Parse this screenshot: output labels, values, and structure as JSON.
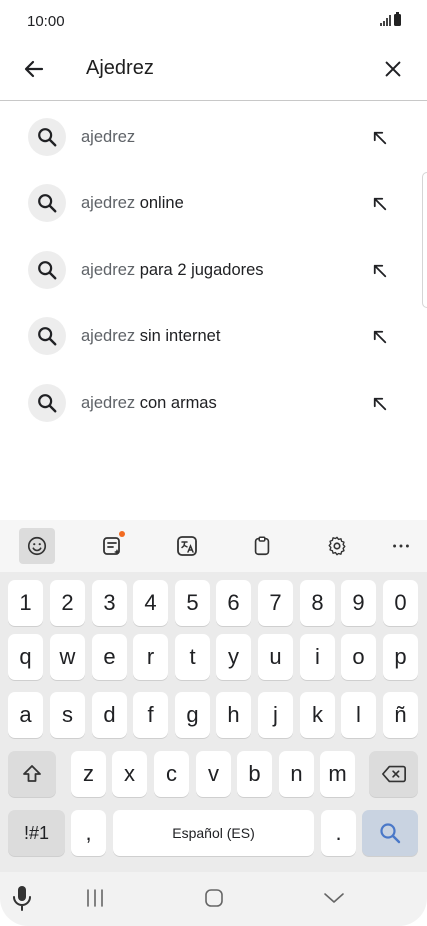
{
  "status_bar": {
    "time": "10:00",
    "icons": [
      "signal-icon",
      "battery-icon"
    ]
  },
  "search_bar": {
    "query": "Ajedrez",
    "icons": {
      "back": "arrow-left-icon",
      "clear": "close-icon"
    }
  },
  "suggestions": [
    {
      "prefix": "ajedrez",
      "rest": ""
    },
    {
      "prefix": "ajedrez",
      "rest": " online"
    },
    {
      "prefix": "ajedrez",
      "rest": " para 2 jugadores"
    },
    {
      "prefix": "ajedrez",
      "rest": " sin internet"
    },
    {
      "prefix": "ajedrez",
      "rest": " con armas"
    }
  ],
  "keyboard": {
    "toolbar": [
      "emoji-icon",
      "ai-writing-icon",
      "translate-icon",
      "clipboard-icon",
      "settings-icon",
      "more-icon"
    ],
    "rows": {
      "numbers": [
        "1",
        "2",
        "3",
        "4",
        "5",
        "6",
        "7",
        "8",
        "9",
        "0"
      ],
      "row1": [
        "q",
        "w",
        "e",
        "r",
        "t",
        "y",
        "u",
        "i",
        "o",
        "p"
      ],
      "row2": [
        "a",
        "s",
        "d",
        "f",
        "g",
        "h",
        "j",
        "k",
        "l",
        "ñ"
      ],
      "row3": [
        "z",
        "x",
        "c",
        "v",
        "b",
        "n",
        "m"
      ]
    },
    "symbols_label": "!#1",
    "comma": ",",
    "space_label": "Español (ES)",
    "period": ".",
    "accent_color": "#4a78c8"
  },
  "nav_bar": {
    "icons": [
      "microphone-icon",
      "recents-icon",
      "home-icon",
      "back-chevron-icon"
    ]
  }
}
